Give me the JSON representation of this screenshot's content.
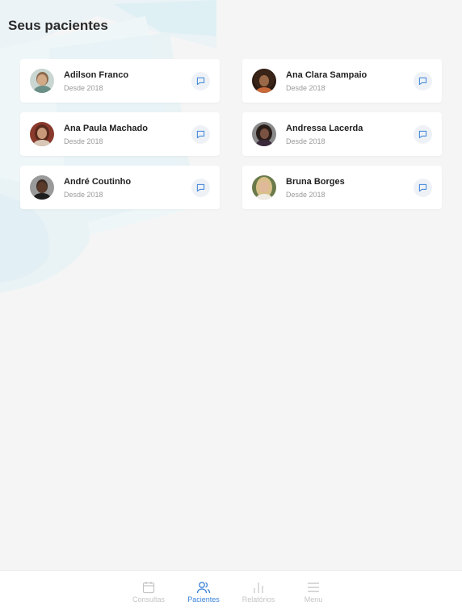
{
  "page": {
    "title": "Seus pacientes"
  },
  "patients": [
    {
      "name": "Adilson Franco",
      "since": "Desde 2018"
    },
    {
      "name": "Ana Clara Sampaio",
      "since": "Desde 2018"
    },
    {
      "name": "Ana Paula Machado",
      "since": "Desde 2018"
    },
    {
      "name": "Andressa Lacerda",
      "since": "Desde 2018"
    },
    {
      "name": "André Coutinho",
      "since": "Desde 2018"
    },
    {
      "name": "Bruna Borges",
      "since": "Desde 2018"
    }
  ],
  "nav": {
    "items": [
      {
        "label": "Consultas",
        "icon": "calendar-icon"
      },
      {
        "label": "Pacientes",
        "icon": "users-icon",
        "active": true
      },
      {
        "label": "Relatórios",
        "icon": "bar-chart-icon"
      },
      {
        "label": "Menu",
        "icon": "menu-icon"
      }
    ]
  },
  "colors": {
    "accent": "#3b82d9",
    "background": "#f5f5f5",
    "inactive": "#c4c4c4"
  }
}
